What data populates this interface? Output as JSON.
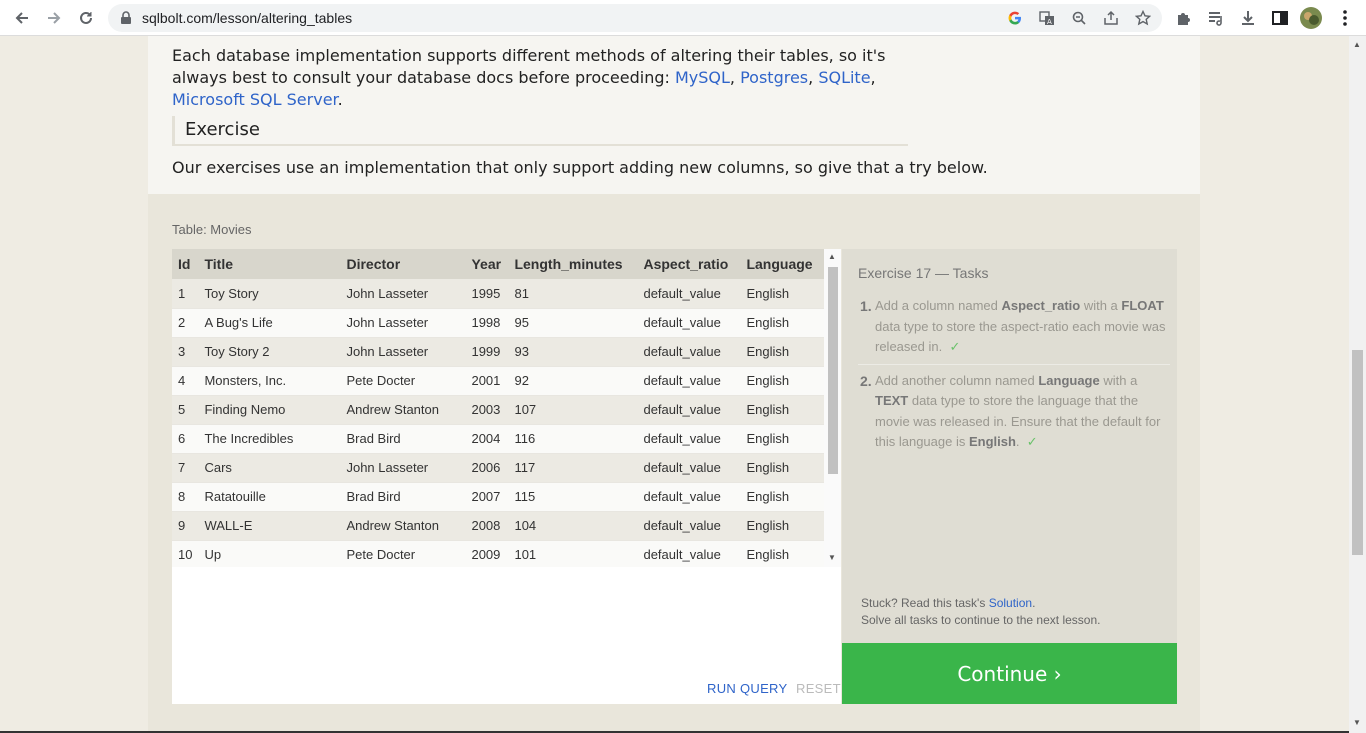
{
  "browser": {
    "url": "sqlbolt.com/lesson/altering_tables"
  },
  "content": {
    "intro_text": "Each database implementation supports different methods of altering their tables, so it's always best to consult your database docs before proceeding: ",
    "links": [
      "MySQL",
      "Postgres",
      "SQLite",
      "Microsoft SQL Server"
    ],
    "exercise_heading": "Exercise",
    "exercise_intro": "Our exercises use an implementation that only support adding new columns, so give that a try below."
  },
  "table": {
    "label": "Table: Movies",
    "columns": [
      "Id",
      "Title",
      "Director",
      "Year",
      "Length_minutes",
      "Aspect_ratio",
      "Language"
    ],
    "rows": [
      [
        "1",
        "Toy Story",
        "John Lasseter",
        "1995",
        "81",
        "default_value",
        "English"
      ],
      [
        "2",
        "A Bug's Life",
        "John Lasseter",
        "1998",
        "95",
        "default_value",
        "English"
      ],
      [
        "3",
        "Toy Story 2",
        "John Lasseter",
        "1999",
        "93",
        "default_value",
        "English"
      ],
      [
        "4",
        "Monsters, Inc.",
        "Pete Docter",
        "2001",
        "92",
        "default_value",
        "English"
      ],
      [
        "5",
        "Finding Nemo",
        "Andrew Stanton",
        "2003",
        "107",
        "default_value",
        "English"
      ],
      [
        "6",
        "The Incredibles",
        "Brad Bird",
        "2004",
        "116",
        "default_value",
        "English"
      ],
      [
        "7",
        "Cars",
        "John Lasseter",
        "2006",
        "117",
        "default_value",
        "English"
      ],
      [
        "8",
        "Ratatouille",
        "Brad Bird",
        "2007",
        "115",
        "default_value",
        "English"
      ],
      [
        "9",
        "WALL-E",
        "Andrew Stanton",
        "2008",
        "104",
        "default_value",
        "English"
      ],
      [
        "10",
        "Up",
        "Pete Docter",
        "2009",
        "101",
        "default_value",
        "English"
      ]
    ]
  },
  "editor": {
    "run_label": "RUN QUERY",
    "reset_label": "RESET"
  },
  "tasks": {
    "title": "Exercise 17 — Tasks",
    "task1": {
      "num": "1.",
      "p1": "Add a column named ",
      "b1": "Aspect_ratio",
      "p2": " with a ",
      "b2": "FLOAT",
      "p3": " data type to store the aspect-ratio each movie was released in.",
      "check": "✓"
    },
    "task2": {
      "num": "2.",
      "p1": "Add another column named ",
      "b1": "Language",
      "p2": " with a ",
      "b2": "TEXT",
      "p3": " data type to store the language that the movie was released in. Ensure that the default for this language is ",
      "b3": "English",
      "p4": ".",
      "check": "✓"
    },
    "stuck_prefix": "Stuck? Read this task's ",
    "solution_link": "Solution",
    "stuck_suffix": ".",
    "continue_hint": "Solve all tasks to continue to the next lesson."
  },
  "continue_label": "Continue ›",
  "colors": {
    "link": "#2f64c9",
    "continue_bg": "#3ab54a",
    "check": "#6ac26a"
  }
}
